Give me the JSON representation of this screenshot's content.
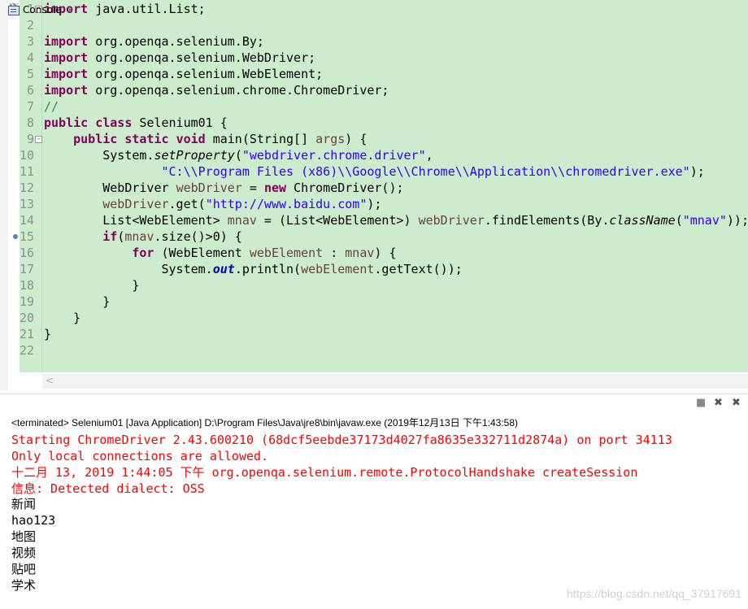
{
  "editor": {
    "line_numbers": [
      "1",
      "2",
      "3",
      "4",
      "5",
      "6",
      "7",
      "8",
      "9",
      "10",
      "11",
      "12",
      "13",
      "14",
      "15",
      "16",
      "17",
      "18",
      "19",
      "20",
      "21",
      "22"
    ],
    "line1": {
      "kw": "import",
      "rest": " java.util.List;"
    },
    "line3": {
      "kw": "import",
      "rest": " org.openqa.selenium.By;"
    },
    "line4": {
      "kw": "import",
      "rest": " org.openqa.selenium.WebDriver;"
    },
    "line5": {
      "kw": "import",
      "rest": " org.openqa.selenium.WebElement;"
    },
    "line6": {
      "kw": "import",
      "rest": " org.openqa.selenium.chrome.ChromeDriver;"
    },
    "line7": {
      "comment": "//"
    },
    "line8": {
      "kw1": "public",
      "kw2": "class",
      "rest": " Selenium01 {"
    },
    "line9": {
      "indent": "    ",
      "kw1": "public",
      "kw2": "static",
      "kw3": "void",
      "a": " main(String[] ",
      "var": "args",
      "b": ") {"
    },
    "line10": {
      "indent": "        ",
      "a": "System.",
      "method": "setProperty",
      "b": "(",
      "str": "\"webdriver.chrome.driver\"",
      "c": ","
    },
    "line11": {
      "indent": "                ",
      "str": "\"C:\\\\Program Files (x86)\\\\Google\\\\Chrome\\\\Application\\\\chromedriver.exe\"",
      "c": ");"
    },
    "line12": {
      "indent": "        ",
      "a": "WebDriver ",
      "var": "webDriver",
      "b": " = ",
      "kw": "new",
      "c": " ChromeDriver();"
    },
    "line13": {
      "indent": "        ",
      "var": "webDriver",
      "a": ".get(",
      "str": "\"http://www.baidu.com\"",
      "b": ");"
    },
    "line14": {
      "indent": "        ",
      "a": "List<WebElement> ",
      "var1": "mnav",
      "b": " = (List<WebElement>) ",
      "var2": "webDriver",
      "c": ".findElements(By.",
      "method": "className",
      "d": "(",
      "str": "\"mnav\"",
      "e": "));"
    },
    "line15": {
      "indent": "        ",
      "kw": "if",
      "a": "(",
      "var": "mnav",
      "b": ".size()>0) {"
    },
    "line16": {
      "indent": "            ",
      "kw": "for",
      "a": " (WebElement ",
      "var1": "webElement",
      "b": " : ",
      "var2": "mnav",
      "c": ") {"
    },
    "line17": {
      "indent": "                ",
      "a": "System.",
      "field": "out",
      "b": ".println(",
      "var": "webElement",
      "c": ".getText());"
    },
    "line18": {
      "text": "            }"
    },
    "line19": {
      "text": "        }"
    },
    "line20": {
      "text": "    }"
    },
    "line21": {
      "text": "}"
    },
    "scroll_left_icon": "<"
  },
  "console": {
    "tab_label": "Console",
    "tab_close": "✕",
    "toolbar_icons": [
      "stop-icon",
      "remove-launch-icon",
      "remove-all-icon"
    ],
    "toolbar_glyphs": [
      "■",
      "✖",
      "✖"
    ],
    "status": "<terminated> Selenium01 [Java Application] D:\\Program Files\\Java\\jre8\\bin\\javaw.exe (2019年12月13日 下午1:43:58)",
    "lines": [
      "Starting ChromeDriver 2.43.600210 (68dcf5eebde37173d4027fa8635e332711d2874a) on port 34113",
      "Only local connections are allowed.",
      "十二月 13, 2019 1:44:05 下午 org.openqa.selenium.remote.ProtocolHandshake createSession",
      "信息: Detected dialect: OSS",
      "新闻",
      "hao123",
      "地图",
      "视频",
      "贴吧",
      "学术"
    ]
  },
  "watermark": "https://blog.csdn.net/qq_37917691",
  "colors": {
    "editor_bg": "#cdeccd",
    "keyword": "#7f0055",
    "string": "#2a00ff",
    "comment": "#3f7f5f",
    "variable": "#6a3e3e",
    "error_output": "#ff0000"
  }
}
